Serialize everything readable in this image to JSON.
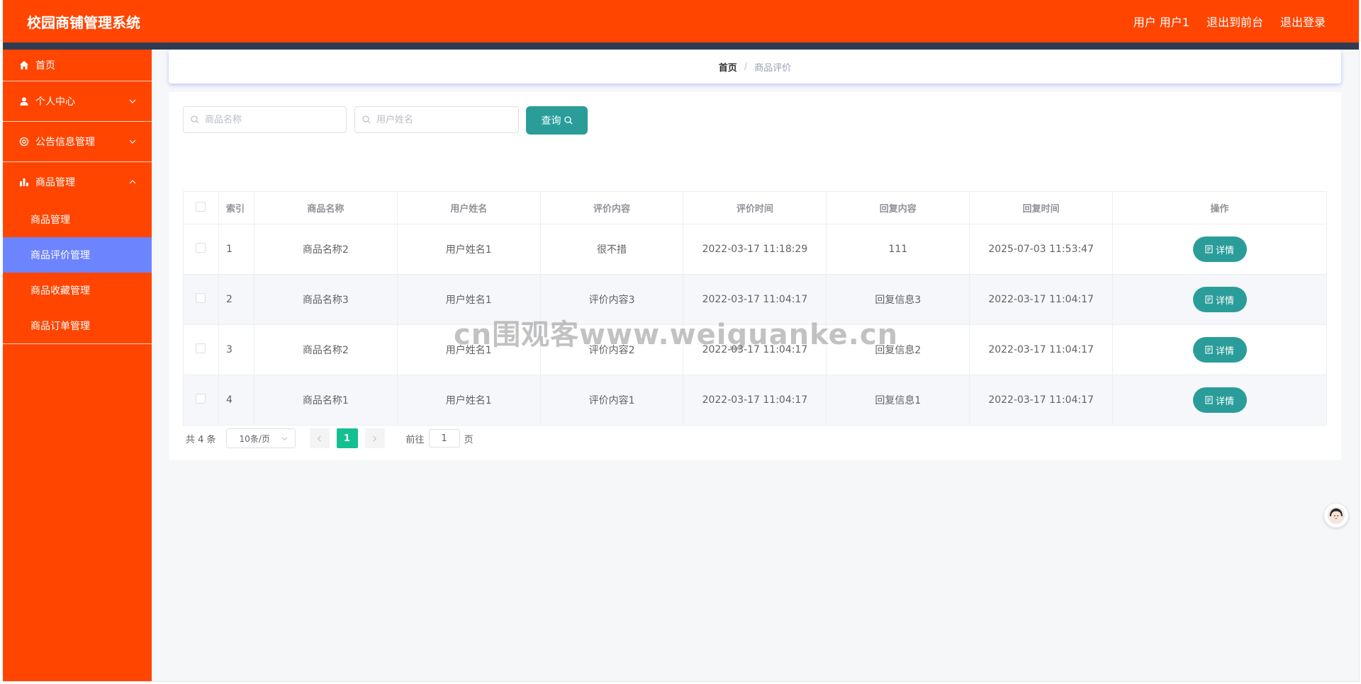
{
  "app": {
    "title": "校园商铺管理系统",
    "user_label": "用户 用户1",
    "back_to_front": "退出到前台",
    "logout": "退出登录"
  },
  "sidebar": {
    "items": [
      {
        "label": "首页",
        "icon": "home-icon"
      },
      {
        "label": "个人中心",
        "icon": "user-icon"
      },
      {
        "label": "公告信息管理",
        "icon": "notice-icon"
      },
      {
        "label": "商品管理",
        "icon": "bar-chart-icon"
      }
    ],
    "submenu": [
      {
        "label": "商品管理"
      },
      {
        "label": "商品评价管理"
      },
      {
        "label": "商品收藏管理"
      },
      {
        "label": "商品订单管理"
      }
    ]
  },
  "breadcrumb": {
    "home": "首页",
    "separator": "/",
    "current": "商品评价"
  },
  "search": {
    "product_placeholder": "商品名称",
    "user_placeholder": "用户姓名",
    "query_label": "查询"
  },
  "table": {
    "headers": [
      "索引",
      "商品名称",
      "用户姓名",
      "评价内容",
      "评价时间",
      "回复内容",
      "回复时间",
      "操作"
    ],
    "detail_label": "详情",
    "rows": [
      {
        "index": "1",
        "product": "商品名称2",
        "user": "用户姓名1",
        "content": "很不措",
        "time": "2022-03-17 11:18:29",
        "reply": "111",
        "reply_time": "2025-07-03 11:53:47"
      },
      {
        "index": "2",
        "product": "商品名称3",
        "user": "用户姓名1",
        "content": "评价内容3",
        "time": "2022-03-17 11:04:17",
        "reply": "回复信息3",
        "reply_time": "2022-03-17 11:04:17"
      },
      {
        "index": "3",
        "product": "商品名称2",
        "user": "用户姓名1",
        "content": "评价内容2",
        "time": "2022-03-17 11:04:17",
        "reply": "回复信息2",
        "reply_time": "2022-03-17 11:04:17"
      },
      {
        "index": "4",
        "product": "商品名称1",
        "user": "用户姓名1",
        "content": "评价内容1",
        "time": "2022-03-17 11:04:17",
        "reply": "回复信息1",
        "reply_time": "2022-03-17 11:04:17"
      }
    ]
  },
  "pagination": {
    "total": "共 4 条",
    "page_size": "10条/页",
    "current_page": "1",
    "goto_label": "前往",
    "goto_value": "1",
    "page_suffix": "页"
  },
  "watermark": "cn围观客www.weiguanke.cn",
  "colors": {
    "header": "#ff4500",
    "sidebar": "#ff4500",
    "active_submenu": "#6d84ff",
    "primary_button": "#2a9d9a",
    "current_page": "#13c08f"
  }
}
